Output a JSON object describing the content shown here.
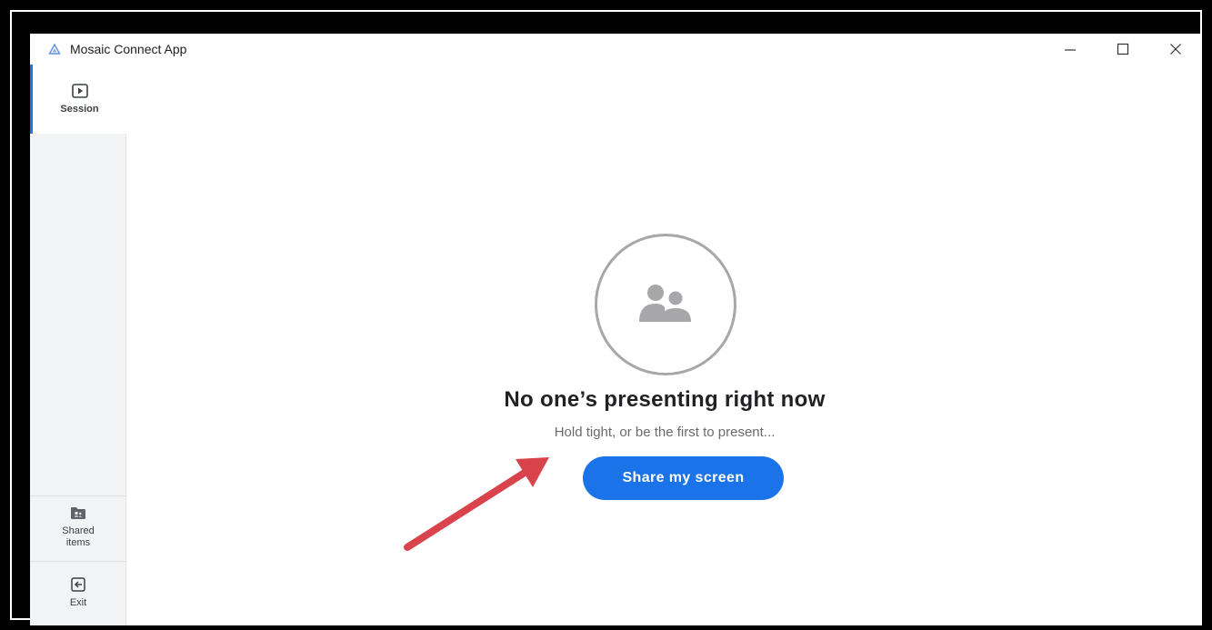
{
  "window": {
    "title": "Mosaic Connect App",
    "logo_icon": "mosaic-logo-icon",
    "controls": [
      "minimize-icon",
      "maximize-icon",
      "close-icon"
    ]
  },
  "sidebar": {
    "items": [
      {
        "label": "Session",
        "icon": "play-icon",
        "active": true
      },
      {
        "label": "Shared items",
        "icon": "shared-folder-icon",
        "active": false
      },
      {
        "label": "Exit",
        "icon": "exit-icon",
        "active": false
      }
    ]
  },
  "main": {
    "empty_icon": "people-icon",
    "title": "No one’s presenting right now",
    "subtitle": "Hold tight, or be the first to present...",
    "share_button_label": "Share my screen"
  },
  "colors": {
    "accent": "#1a73e8",
    "annotation_arrow": "#d9434b",
    "frame": "#000000"
  }
}
